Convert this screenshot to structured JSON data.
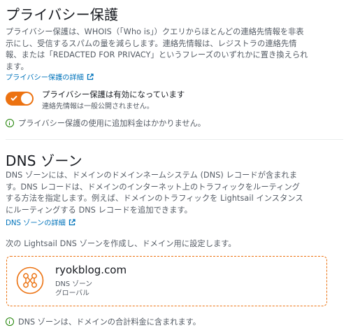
{
  "privacy": {
    "title": "プライバシー保護",
    "description_lines": [
      "プライバシー保護は、WHOIS（「Who is」）クエリからほとんどの連絡先情報を非表",
      "示にし、受信するスパムの量を減らします。連絡先情報は、レジストラの連絡先情",
      "報、または「REDACTED FOR PRIVACY」というフレーズのいずれかに置き換えられ",
      "ます。"
    ],
    "details_link": "プライバシー保護の詳細",
    "toggle_on": true,
    "toggle_label": "プライバシー保護は有効になっています",
    "toggle_sub": "連絡先情報は一般公開されません。",
    "info": "プライバシー保護の使用に追加料金はかかりません。"
  },
  "dns": {
    "title": "DNS ゾーン",
    "description_lines": [
      "DNS ゾーンには、ドメインのドメインネームシステム (DNS) レコードが含まれま",
      "す。DNS レコードは、ドメインのインターネット上のトラフィックをルーティング",
      "する方法を指定します。例えば、ドメインのトラフィックを Lightsail インスタンス",
      "にルーティングする DNS レコードを追加できます。"
    ],
    "details_link": "DNS ゾーンの詳細",
    "create_text": "次の Lightsail DNS ゾーンを作成し、ドメイン用に設定します。",
    "zone": {
      "name": "ryokblog.com",
      "type": "DNS ゾーン",
      "scope": "グローバル"
    },
    "info": "DNS ゾーンは、ドメインの合計料金に含まれます。"
  },
  "colors": {
    "accent": "#ec7211",
    "link": "#0073bb",
    "success": "#1d8102",
    "text": "#16191f",
    "muted": "#545b64"
  },
  "icons": [
    "external-link-icon",
    "check-icon",
    "info-icon",
    "dns-zone-icon"
  ]
}
